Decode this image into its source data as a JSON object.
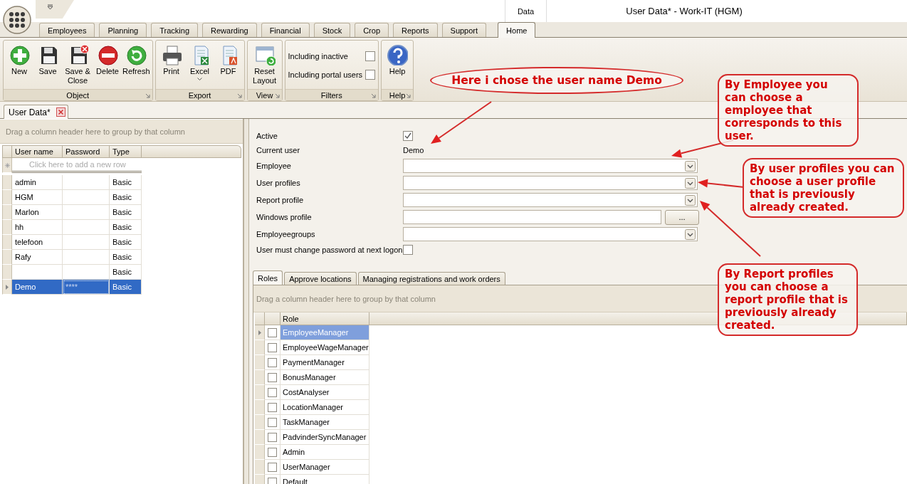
{
  "title_bar": {
    "context_tab": "Data",
    "title": "User Data* - Work-IT (HGM)"
  },
  "ribbon_tabs": [
    {
      "label": "Employees",
      "selected": false
    },
    {
      "label": "Planning",
      "selected": false
    },
    {
      "label": "Tracking",
      "selected": false
    },
    {
      "label": "Rewarding",
      "selected": false
    },
    {
      "label": "Financial",
      "selected": false
    },
    {
      "label": "Stock",
      "selected": false
    },
    {
      "label": "Crop",
      "selected": false
    },
    {
      "label": "Reports",
      "selected": false
    },
    {
      "label": "Support",
      "selected": false
    },
    {
      "label": "Home",
      "selected": true
    }
  ],
  "ribbon_groups": [
    {
      "title": "Object",
      "items": [
        {
          "kind": "button",
          "label": "New"
        },
        {
          "kind": "button",
          "label": "Save"
        },
        {
          "kind": "button",
          "label": "Save & Close"
        },
        {
          "kind": "button",
          "label": "Delete"
        },
        {
          "kind": "button",
          "label": "Refresh"
        }
      ]
    },
    {
      "title": "Export",
      "items": [
        {
          "kind": "button",
          "label": "Print"
        },
        {
          "kind": "button",
          "label": "Excel",
          "dropdown": true
        },
        {
          "kind": "button",
          "label": "PDF"
        }
      ]
    },
    {
      "title": "View",
      "items": [
        {
          "kind": "button",
          "label": "Reset Layout"
        }
      ]
    },
    {
      "title": "Filters",
      "items": [
        {
          "kind": "checkbox",
          "label": "Including inactive",
          "checked": false
        },
        {
          "kind": "checkbox",
          "label": "Including portal users",
          "checked": false
        }
      ]
    },
    {
      "title": "Help",
      "items": [
        {
          "kind": "button",
          "label": "Help"
        }
      ]
    }
  ],
  "document_tabs": [
    {
      "label": "User Data*",
      "selected": true
    }
  ],
  "users_grid": {
    "group_hint": "Drag a column header here to group by that column",
    "columns": [
      "User name",
      "Password",
      "Type"
    ],
    "new_row_hint": "Click here to add a new row",
    "rows": [
      {
        "user_name": "admin",
        "type": "Basic",
        "selected": false
      },
      {
        "user_name": "HGM",
        "type": "Basic",
        "selected": false
      },
      {
        "user_name": "Marlon",
        "type": "Basic",
        "selected": false
      },
      {
        "user_name": "hh",
        "type": "Basic",
        "selected": false
      },
      {
        "user_name": "telefoon",
        "type": "Basic",
        "selected": false
      },
      {
        "user_name": "Rafy",
        "type": "Basic",
        "selected": false
      },
      {
        "type": "Basic",
        "selected": false
      },
      {
        "user_name": "Demo",
        "password": "****",
        "type": "Basic",
        "selected": true
      }
    ]
  },
  "form": {
    "fields": [
      {
        "kind": "checkbox",
        "label": "Active",
        "checked": true
      },
      {
        "kind": "text",
        "label": "Current user",
        "value": "Demo"
      },
      {
        "kind": "combo",
        "label": "Employee"
      },
      {
        "kind": "combo",
        "label": "User profiles"
      },
      {
        "kind": "combo",
        "label": "Report profile"
      },
      {
        "kind": "browse",
        "label": "Windows profile",
        "button": "..."
      },
      {
        "kind": "combo",
        "label": "Employeegroups"
      },
      {
        "kind": "checkbox",
        "label": "User must change password at next logon",
        "checked": false
      }
    ]
  },
  "detail_tabs": [
    {
      "label": "Roles",
      "selected": true
    },
    {
      "label": "Approve locations",
      "selected": false
    },
    {
      "label": "Managing registrations and work orders",
      "selected": false
    }
  ],
  "roles_grid": {
    "group_hint": "Drag a column header here to group by that column",
    "column": "Role",
    "rows": [
      {
        "role": "EmployeeManager",
        "checked": false,
        "selected": true
      },
      {
        "role": "EmployeeWageManager",
        "checked": false,
        "selected": false
      },
      {
        "role": "PaymentManager",
        "checked": false,
        "selected": false
      },
      {
        "role": "BonusManager",
        "checked": false,
        "selected": false
      },
      {
        "role": "CostAnalyser",
        "checked": false,
        "selected": false
      },
      {
        "role": "LocationManager",
        "checked": false,
        "selected": false
      },
      {
        "role": "TaskManager",
        "checked": false,
        "selected": false
      },
      {
        "role": "PadvinderSyncManager",
        "checked": false,
        "selected": false
      },
      {
        "role": "Admin",
        "checked": false,
        "selected": false
      },
      {
        "role": "UserManager",
        "checked": false,
        "selected": false
      },
      {
        "role": "Default",
        "checked": false,
        "selected": false
      }
    ]
  },
  "annotations": [
    {
      "kind": "ellipse",
      "text": "Here i chose the user name Demo"
    },
    {
      "kind": "rounded",
      "text": "By Employee you can choose a employee that corresponds to this user."
    },
    {
      "kind": "rounded",
      "text": "By user profiles you can choose a user profile that is previously already created."
    },
    {
      "kind": "rounded",
      "text": "By Report profiles you can choose a report profile that is previously already created."
    }
  ]
}
